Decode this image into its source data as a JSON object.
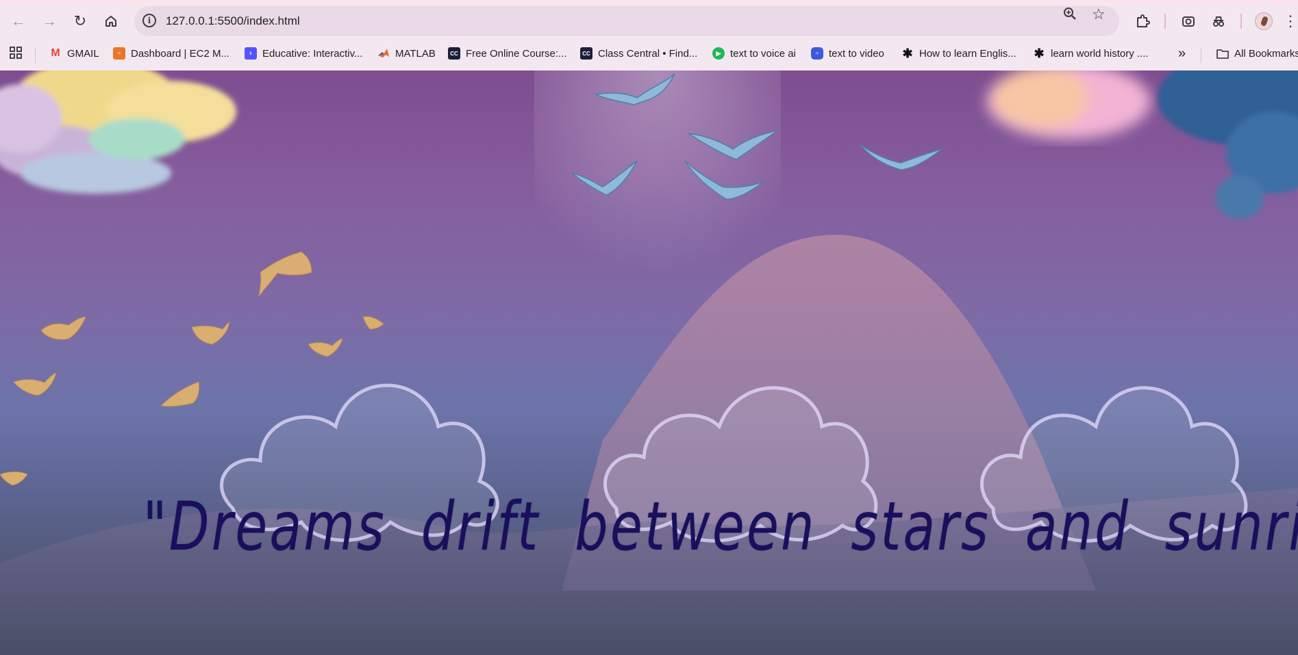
{
  "browser": {
    "url": "127.0.0.1:5500/index.html",
    "bookmarks": [
      {
        "label": "GMAIL",
        "icon": "gmail-icon",
        "color": "#ea4335"
      },
      {
        "label": "Dashboard | EC2 M...",
        "icon": "aws-ec2-icon",
        "color": "#e8762c"
      },
      {
        "label": "Educative: Interactiv...",
        "icon": "educative-icon",
        "color": "#5553ff"
      },
      {
        "label": "MATLAB",
        "icon": "matlab-icon",
        "color": "#e16737"
      },
      {
        "label": "Free Online Course:...",
        "icon": "class-central-icon",
        "color": "#1d1f3a"
      },
      {
        "label": "Class Central • Find...",
        "icon": "class-central-icon",
        "color": "#1d1f3a"
      },
      {
        "label": "text to voice ai",
        "icon": "play-icon",
        "color": "#1db954"
      },
      {
        "label": "text to video",
        "icon": "video-icon",
        "color": "#3b5bdb"
      },
      {
        "label": "How to learn Englis...",
        "icon": "claude-icon",
        "color": "#111111"
      },
      {
        "label": "learn world history ....",
        "icon": "claude-icon",
        "color": "#111111"
      }
    ],
    "more_label": "»",
    "all_bookmarks_label": "All Bookmarks"
  },
  "page": {
    "quote": "\"Dreams drift between stars and sunrise.\""
  }
}
